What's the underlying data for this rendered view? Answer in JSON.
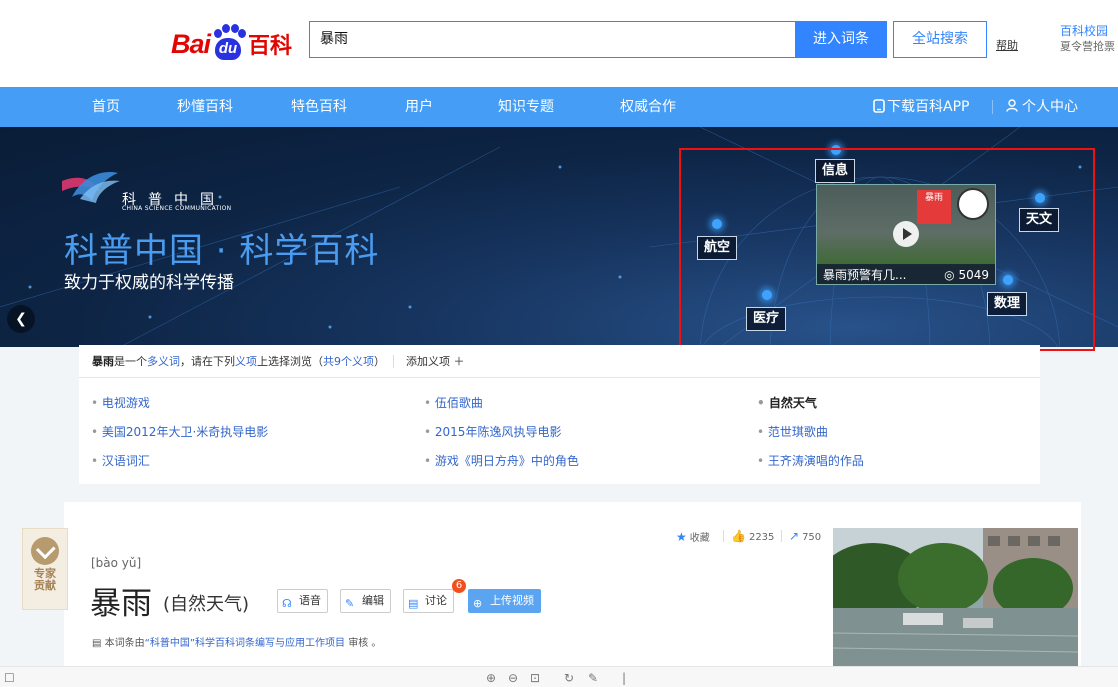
{
  "header": {
    "logo_bai": "Bai",
    "logo_du": "du",
    "logo_baike": "百科",
    "search_value": "暴雨",
    "enter_label": "进入词条",
    "global_label": "全站搜索",
    "help_label": "帮助",
    "promo_line1": "百科校园",
    "promo_line2": "夏令营抢票"
  },
  "nav": {
    "items": [
      "首页",
      "秒懂百科",
      "特色百科",
      "用户",
      "知识专题",
      "权威合作"
    ],
    "download_app": "下载百科APP",
    "personal": "个人中心"
  },
  "banner": {
    "logo_cn": "科普中国",
    "logo_en": "CHINA SCIENCE COMMUNICATION",
    "title": "科普中国 · 科学百科",
    "subtitle": "致力于权威的科学传播",
    "tags": [
      "信息",
      "天文",
      "航空",
      "医疗",
      "数理"
    ],
    "video_caption": "暴雨预警有几...",
    "video_views": "5049",
    "video_badge": "暴雨"
  },
  "polysemy": {
    "term": "暴雨",
    "text_a": "是一个",
    "link_multi": "多义词",
    "text_b": "，请在下列",
    "link_item": "义项",
    "text_c": "上选择浏览（",
    "link_count": "共9个义项",
    "text_d": "）",
    "add_label": "添加义项 ＋",
    "items": [
      [
        "电视游戏",
        "伍佰歌曲",
        "自然天气"
      ],
      [
        "美国2012年大卫·米奇执导电影",
        "2015年陈逸风执导电影",
        "范世琪歌曲"
      ],
      [
        "汉语词汇",
        "游戏《明日方舟》中的角色",
        "王齐涛演唱的作品"
      ]
    ]
  },
  "entry": {
    "pinyin": "[bào yǔ]",
    "title": "暴雨",
    "subtitle": "(自然天气)",
    "voice_label": "语音",
    "edit_label": "编辑",
    "discuss_label": "讨论",
    "discuss_count": "6",
    "upload_label": "上传视频",
    "review_prefix": "本词条由",
    "review_link": "“科普中国”科学百科词条编写与应用工作项目",
    "review_suffix": " 审核 。",
    "collect_label": "收藏",
    "like_count": "2235",
    "share_count": "750",
    "expert_line1": "专家",
    "expert_line2": "贡献"
  },
  "colors": {
    "accent": "#3385ff",
    "nav_bg": "#459df5",
    "link": "#3366cc",
    "highlight_box": "#ee1111"
  }
}
